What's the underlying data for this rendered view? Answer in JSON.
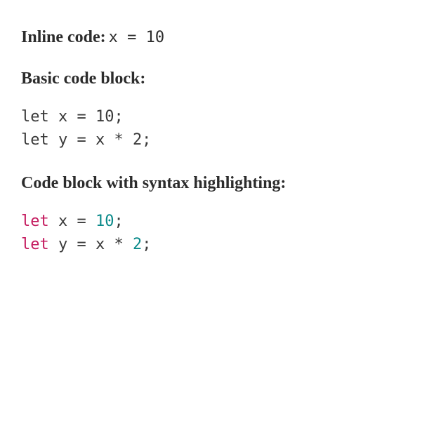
{
  "section1": {
    "heading": "Inline code:",
    "code": "x = 10"
  },
  "section2": {
    "heading": "Basic code block:",
    "code_lines": [
      "let x = 10;",
      "let y = x * 2;"
    ]
  },
  "section3": {
    "heading": "Code block with syntax highlighting:",
    "code_lines": [
      {
        "tokens": [
          {
            "text": "let",
            "type": "keyword"
          },
          {
            "text": " ",
            "type": "space"
          },
          {
            "text": "x",
            "type": "ident"
          },
          {
            "text": " ",
            "type": "space"
          },
          {
            "text": "=",
            "type": "punct"
          },
          {
            "text": " ",
            "type": "space"
          },
          {
            "text": "10",
            "type": "number"
          },
          {
            "text": ";",
            "type": "punct"
          }
        ]
      },
      {
        "tokens": [
          {
            "text": "let",
            "type": "keyword"
          },
          {
            "text": " ",
            "type": "space"
          },
          {
            "text": "y",
            "type": "ident"
          },
          {
            "text": " ",
            "type": "space"
          },
          {
            "text": "=",
            "type": "punct"
          },
          {
            "text": " ",
            "type": "space"
          },
          {
            "text": "x",
            "type": "ident"
          },
          {
            "text": " ",
            "type": "space"
          },
          {
            "text": "*",
            "type": "punct"
          },
          {
            "text": " ",
            "type": "space"
          },
          {
            "text": "2",
            "type": "number"
          },
          {
            "text": ";",
            "type": "punct"
          }
        ]
      }
    ]
  },
  "colors": {
    "keyword": "#c41a5e",
    "number": "#0a8a8a",
    "text": "#3a3a3a"
  }
}
